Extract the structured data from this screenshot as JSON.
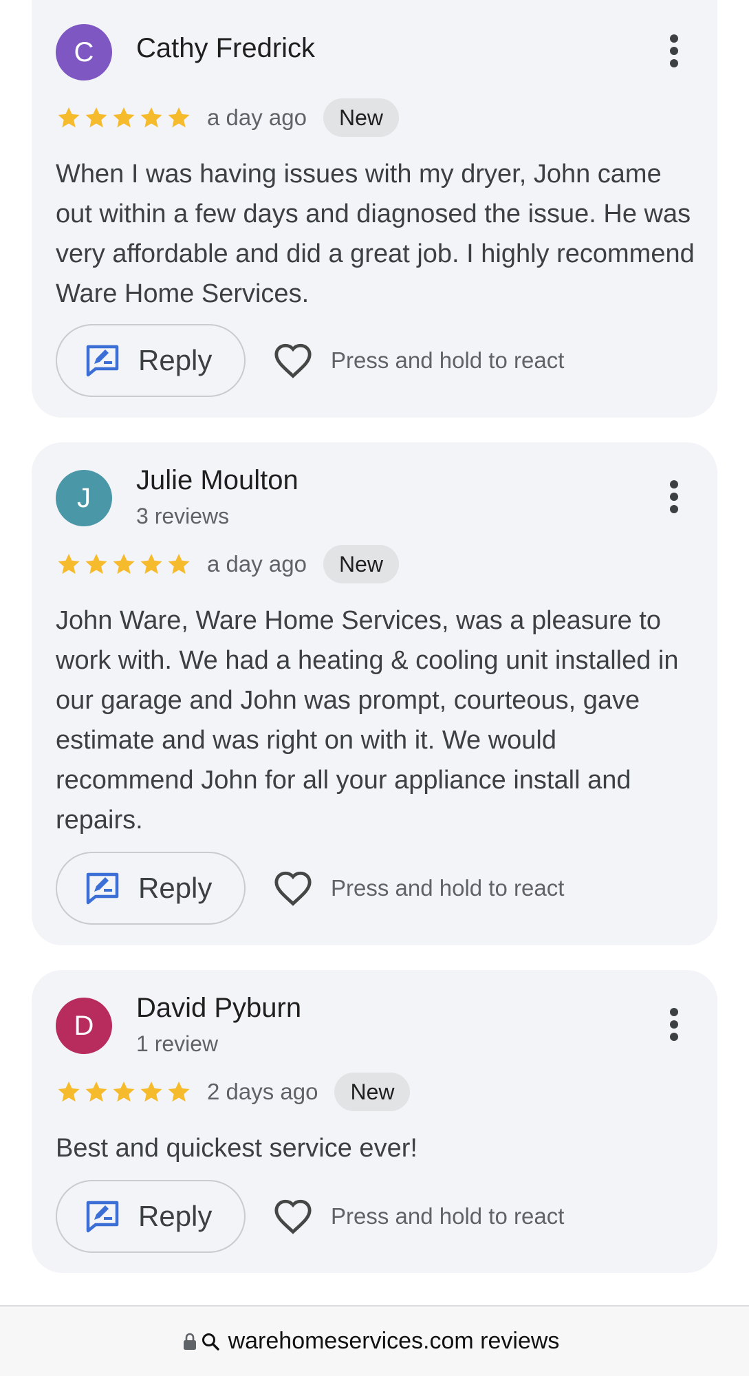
{
  "reviews": [
    {
      "initial": "C",
      "avatar_color": "#7e57c2",
      "name": "Cathy Fredrick",
      "subtext": "",
      "rating": 5,
      "time": "a day ago",
      "badge": "New",
      "text": "When I was having issues with my dryer, John came out within a few days and diagnosed the issue. He was very affordable and did a great job. I highly recommend Ware Home Services.",
      "reply_label": "Reply",
      "react_label": "Press and hold to react"
    },
    {
      "initial": "J",
      "avatar_color": "#4a97a8",
      "name": "Julie Moulton",
      "subtext": "3 reviews",
      "rating": 5,
      "time": "a day ago",
      "badge": "New",
      "text": "John Ware, Ware Home Services, was a pleasure to work with. We had a heating & cooling unit installed in our garage and John was prompt, courteous, gave estimate and was right on with it. We would recommend John for all your appliance install and repairs.",
      "reply_label": "Reply",
      "react_label": "Press and hold to react"
    },
    {
      "initial": "D",
      "avatar_color": "#b72c5c",
      "name": "David Pyburn",
      "subtext": "1 review",
      "rating": 5,
      "time": "2 days ago",
      "badge": "New",
      "text": "Best and quickest service ever!",
      "reply_label": "Reply",
      "react_label": "Press and hold to react"
    }
  ],
  "footer": {
    "url": "warehomeservices.com reviews",
    "icons": [
      "lock-icon",
      "search-icon"
    ]
  },
  "colors": {
    "star": "#f6bb2d",
    "reply_icon": "#3b6fd6",
    "card_bg": "#f3f4f7"
  }
}
